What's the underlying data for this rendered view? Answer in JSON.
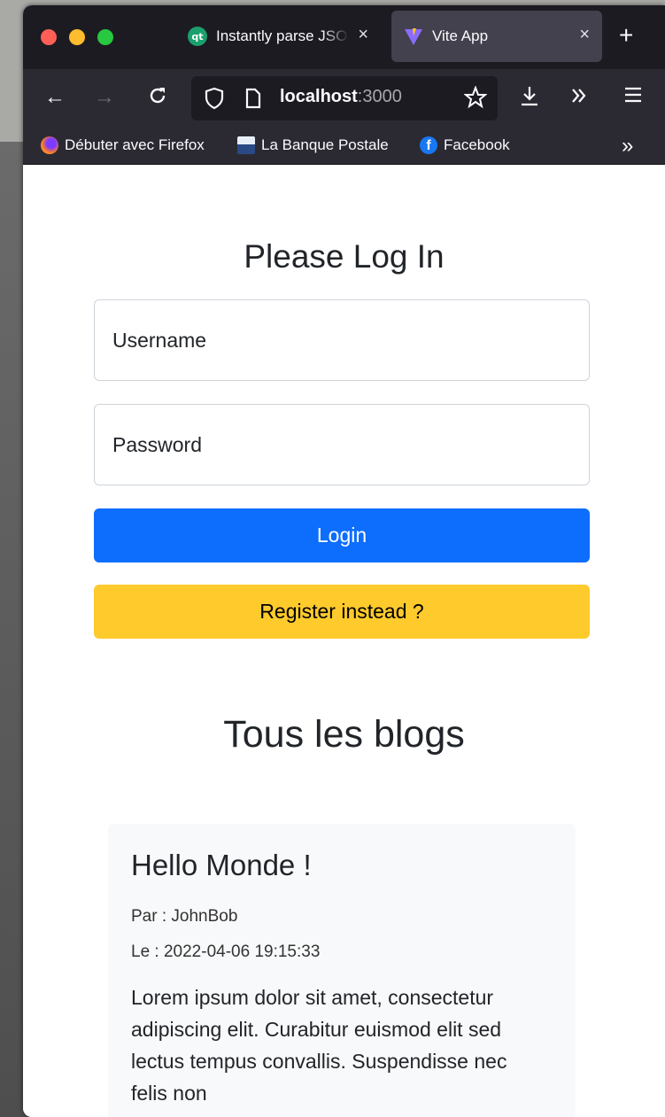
{
  "browser": {
    "tabs": [
      {
        "label": "Instantly parse JSON",
        "favicon": "qt-icon",
        "active": false
      },
      {
        "label": "Vite App",
        "favicon": "vite-icon",
        "active": true
      }
    ],
    "close_glyph": "×",
    "new_tab_glyph": "+",
    "url_host": "localhost",
    "url_port": ":3000",
    "bookmarks": [
      {
        "label": "Débuter avec Firefox",
        "icon": "firefox-icon"
      },
      {
        "label": "La Banque Postale",
        "icon": "banque-postale-icon"
      },
      {
        "label": "Facebook",
        "icon": "facebook-icon"
      }
    ],
    "overflow_glyph": "»"
  },
  "login": {
    "title": "Please Log In",
    "username_placeholder": "Username",
    "password_placeholder": "Password",
    "login_label": "Login",
    "register_label": "Register instead ?"
  },
  "blogs": {
    "heading": "Tous les blogs",
    "posts": [
      {
        "title": "Hello Monde !",
        "author": "Par : JohnBob",
        "date": "Le : 2022-04-06 19:15:33",
        "body": "Lorem ipsum dolor sit amet, consectetur adipiscing elit. Curabitur euismod elit sed lectus tempus convallis. Suspendisse nec felis non"
      }
    ]
  },
  "colors": {
    "primary": "#0d6efd",
    "warning": "#ffca2c"
  }
}
